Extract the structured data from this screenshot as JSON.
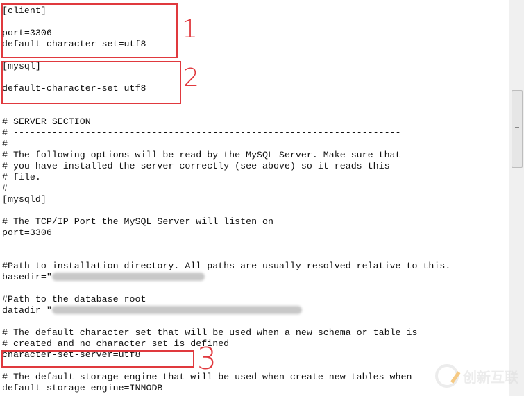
{
  "lines": [
    "[client]",
    "",
    "port=3306",
    "default-character-set=utf8",
    "",
    "[mysql]",
    "",
    "default-character-set=utf8",
    "",
    "",
    "# SERVER SECTION",
    "# ----------------------------------------------------------------------",
    "#",
    "# The following options will be read by the MySQL Server. Make sure that",
    "# you have installed the server correctly (see above) so it reads this",
    "# file.",
    "#",
    "[mysqld]",
    "",
    "# The TCP/IP Port the MySQL Server will listen on",
    "port=3306",
    "",
    "",
    "#Path to installation directory. All paths are usually resolved relative to this.",
    "basedir=\"",
    "",
    "#Path to the database root",
    "datadir=\"",
    "",
    "# The default character set that will be used when a new schema or table is",
    "# created and no character set is defined",
    "character-set-server=utf8",
    "",
    "# The default storage engine that will be used when create new tables when",
    "default-storage-engine=INNODB"
  ],
  "annotations": {
    "one": "1",
    "two": "2",
    "three": "3",
    "color": "#e0393e"
  },
  "watermark": "创新互联"
}
